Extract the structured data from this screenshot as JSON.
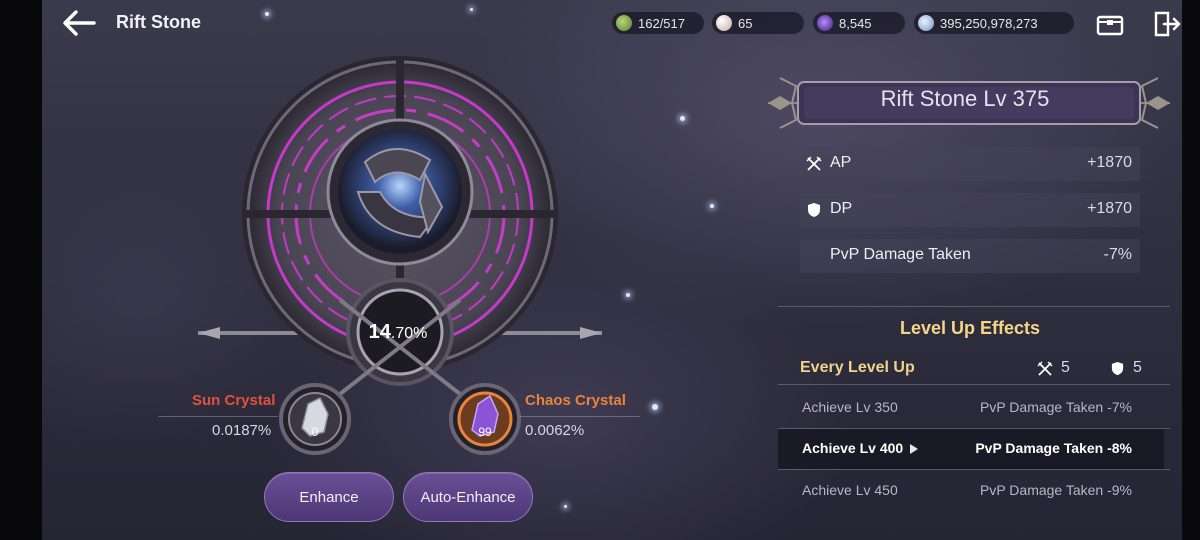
{
  "header": {
    "title": "Rift Stone"
  },
  "resources": [
    {
      "id": "energy",
      "value": "162/517",
      "color": "#6f9a3c"
    },
    {
      "id": "pearls",
      "value": "65",
      "color": "#d9c9c9"
    },
    {
      "id": "dark-orbs",
      "value": "8,545",
      "color": "#6a3fb0"
    },
    {
      "id": "silver",
      "value": "395,250,978,273",
      "color": "#8fb3d9"
    }
  ],
  "enhance": {
    "rate_int": "14",
    "rate_dec": ".70%",
    "sun_crystal": {
      "name": "Sun Crystal",
      "rate": "0.0187%",
      "count": "0",
      "color": "#e0513a"
    },
    "chaos_crystal": {
      "name": "Chaos Crystal",
      "rate": "0.0062%",
      "count": "99",
      "color": "#e8843c"
    },
    "enhance_label": "Enhance",
    "auto_enhance_label": "Auto-Enhance"
  },
  "panel": {
    "title": "Rift Stone Lv 375",
    "stats": [
      {
        "label": "AP",
        "value": "+1870",
        "icon": "crossed-swords-icon"
      },
      {
        "label": "DP",
        "value": "+1870",
        "icon": "shield-icon"
      },
      {
        "label": "PvP Damage Taken",
        "value": "-7%",
        "icon": ""
      }
    ],
    "level_up": {
      "title": "Level Up Effects",
      "every_label": "Every Level Up",
      "every_ap": "5",
      "every_dp": "5",
      "milestones": [
        {
          "level": "Achieve Lv 350",
          "effect": "PvP Damage Taken -7%",
          "active": false
        },
        {
          "level": "Achieve Lv 400",
          "effect": "PvP Damage Taken -8%",
          "active": true
        },
        {
          "level": "Achieve Lv 450",
          "effect": "PvP Damage Taken -9%",
          "active": false
        }
      ]
    }
  },
  "colors": {
    "accent_gold": "#f4d687",
    "button_purple": "#5c4387",
    "rune_magenta": "#d43bd6"
  }
}
